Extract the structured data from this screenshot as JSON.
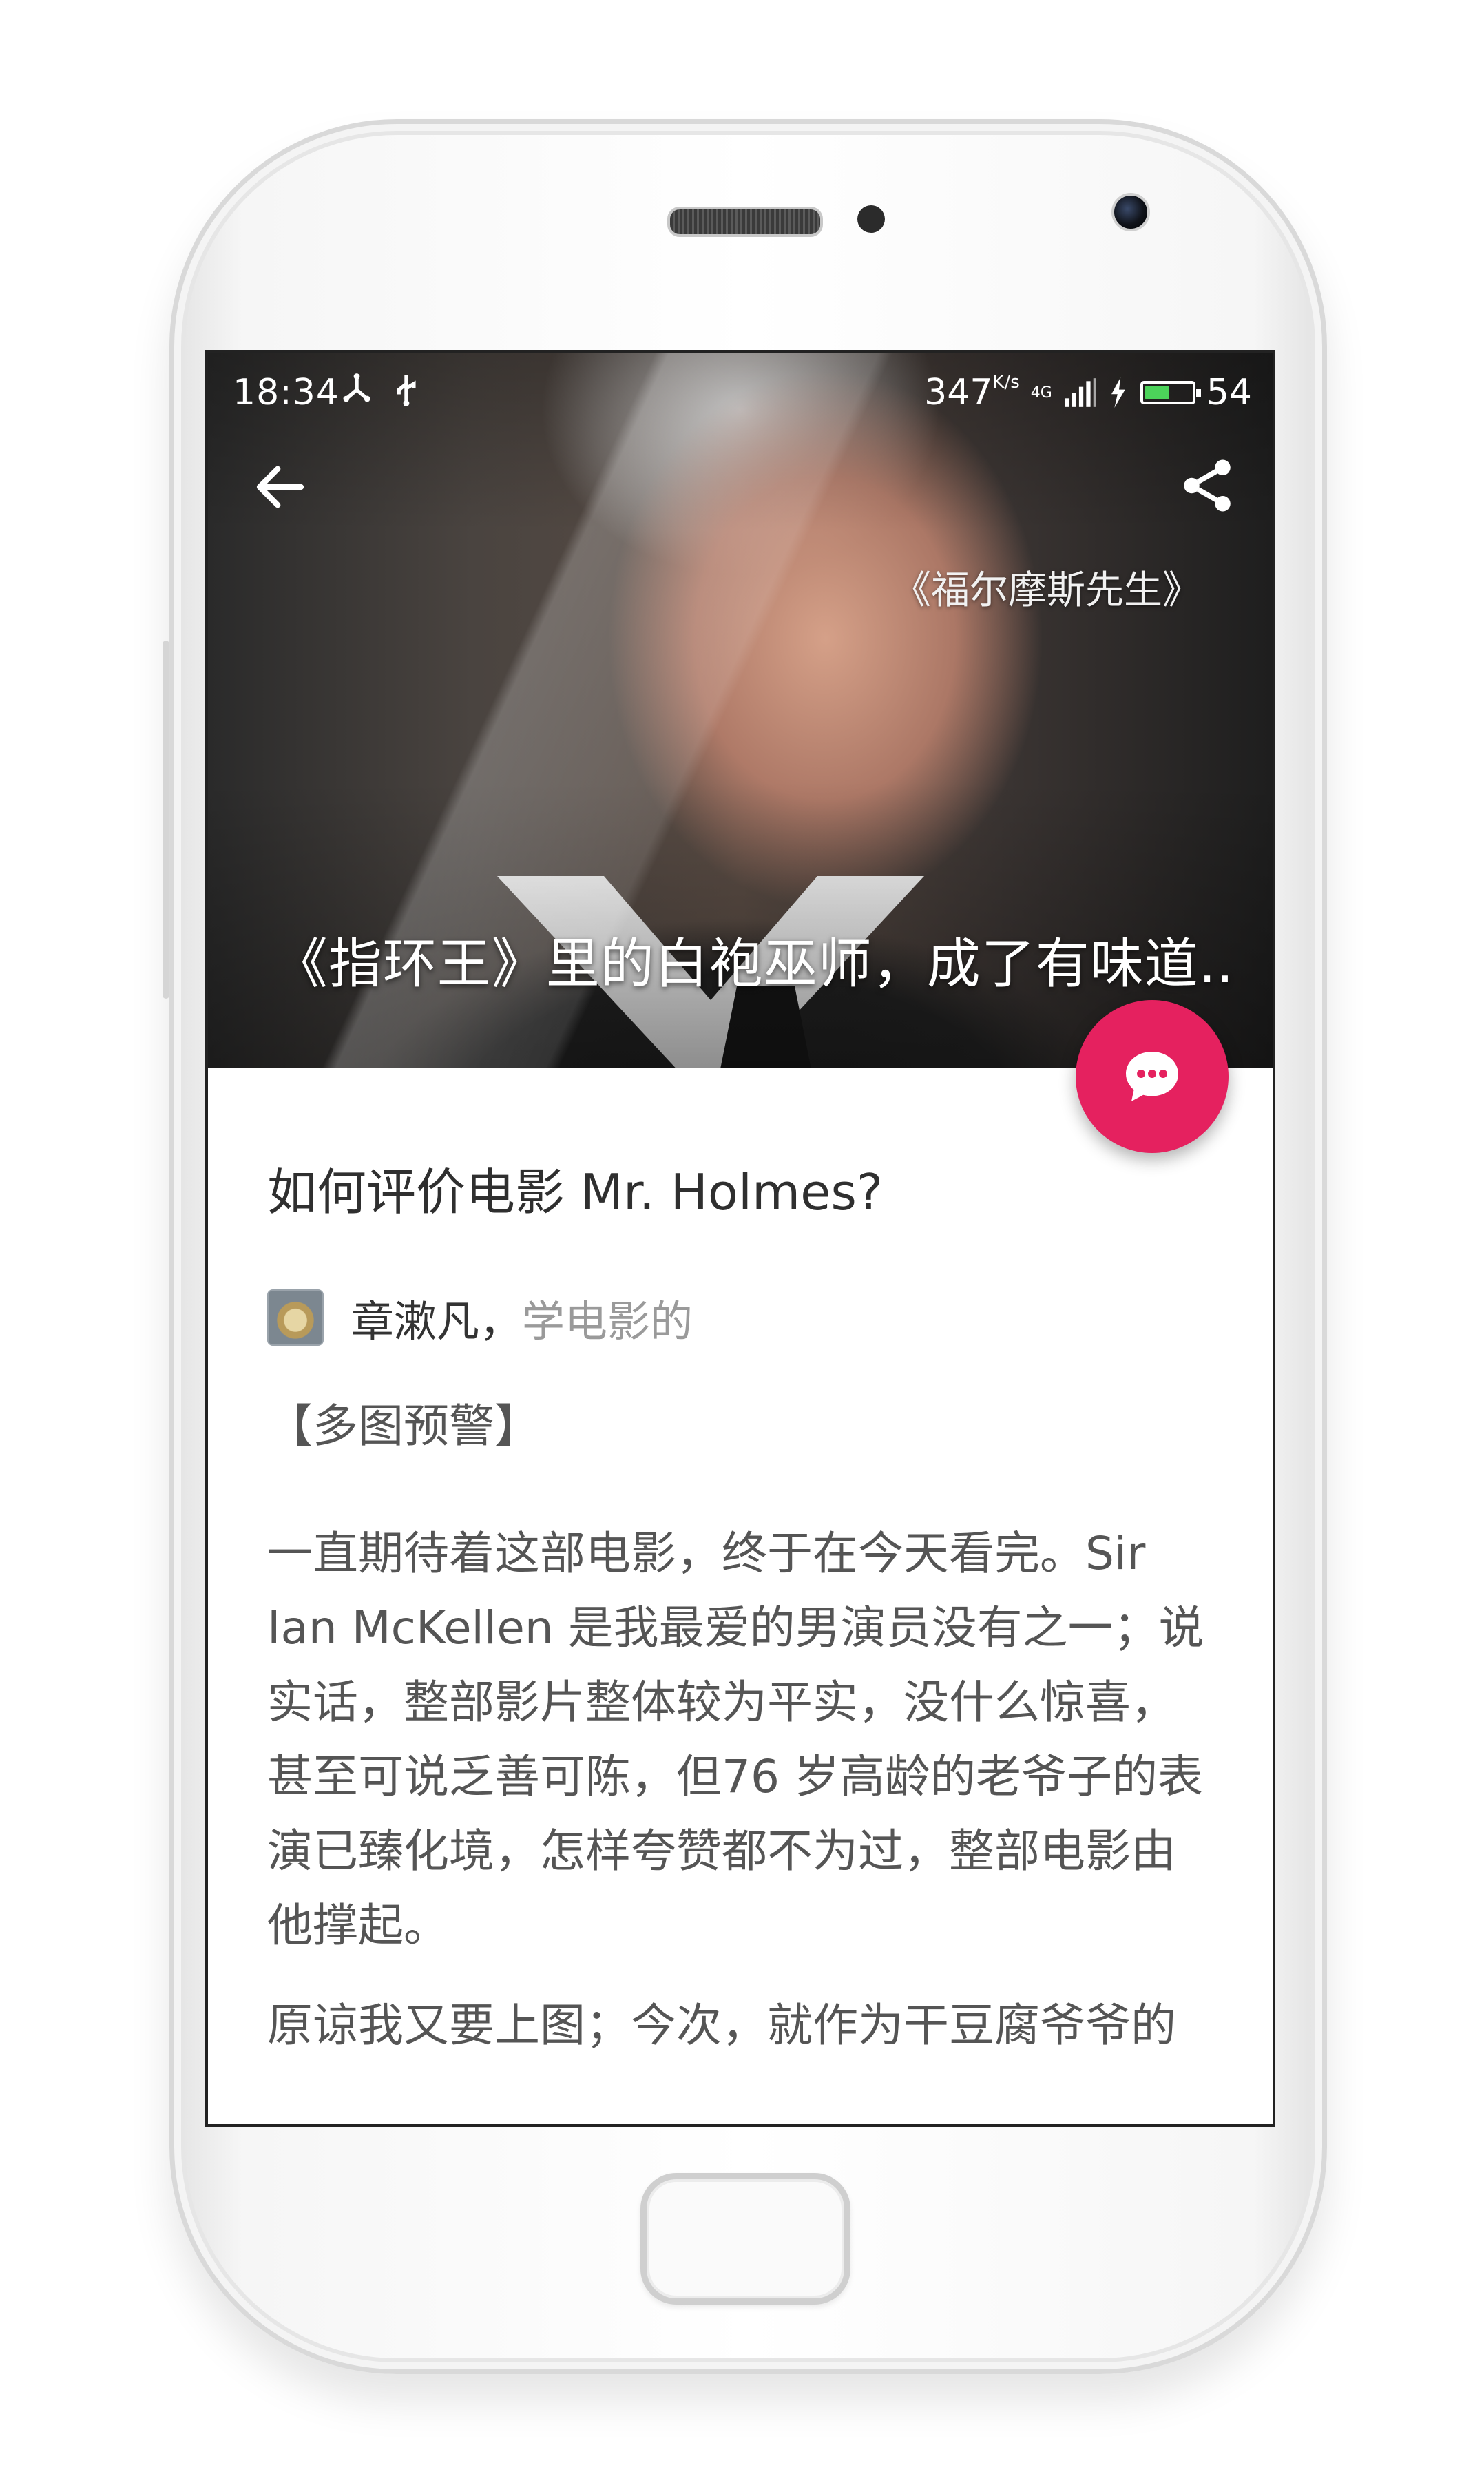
{
  "status_bar": {
    "time": "18:34",
    "net_speed": "347",
    "net_unit": "K/s",
    "network": "4G",
    "battery_level": "54",
    "battery_fill_fraction": 0.54,
    "battery_color": "#4cd35a"
  },
  "hero": {
    "movie_tag": "《福尔摩斯先生》",
    "caption": "《指环王》里的白袍巫师，成了有味道.."
  },
  "article": {
    "title": "如何评价电影 Mr. Holmes?",
    "author_name": "章漱凡，",
    "author_bio": "学电影的",
    "intro": "【多图预警】",
    "body_1": "一直期待着这部电影，终于在今天看完。Sir Ian McKellen 是我最爱的男演员没有之一；说实话，整部影片整体较为平实，没什么惊喜，甚至可说乏善可陈，但76 岁高龄的老爷子的表演已臻化境，怎样夸赞都不为过，整部电影由他撑起。",
    "body_2": "原谅我又要上图；今次，就作为干豆腐爷爷的"
  },
  "colors": {
    "fab": "#e5215f",
    "text_primary": "#2f2f2f",
    "text_secondary": "#9a9a9a"
  },
  "icons": {
    "back": "arrow-left-icon",
    "share": "share-icon",
    "fab": "comment-icon"
  }
}
